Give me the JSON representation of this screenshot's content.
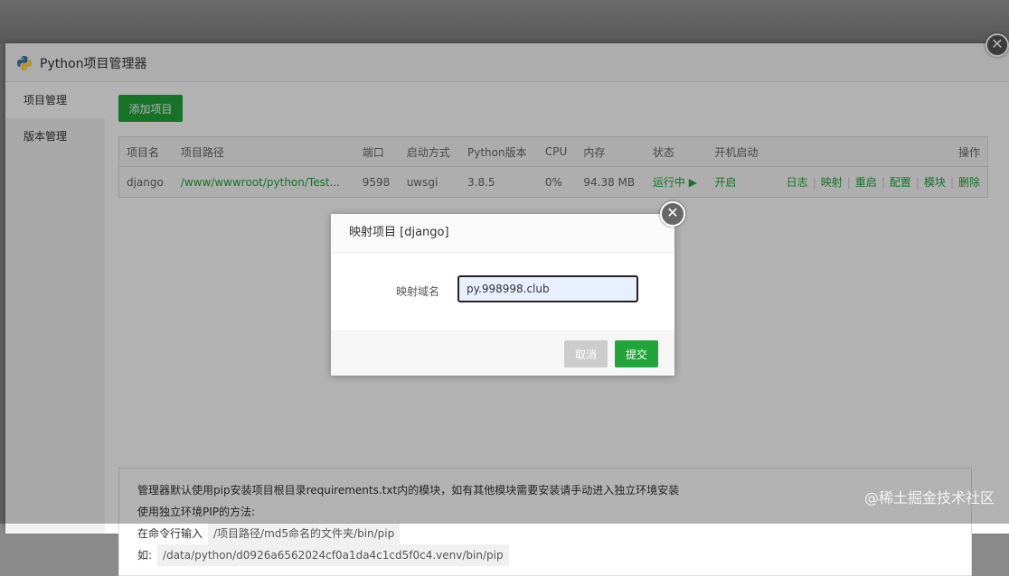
{
  "window": {
    "title": "Python项目管理器"
  },
  "sidebar": {
    "items": [
      {
        "label": "项目管理"
      },
      {
        "label": "版本管理"
      }
    ]
  },
  "toolbar": {
    "add_label": "添加项目"
  },
  "table": {
    "headers": [
      "项目名",
      "项目路径",
      "端口",
      "启动方式",
      "Python版本",
      "CPU",
      "内存",
      "状态",
      "开机启动",
      "操作"
    ],
    "row": {
      "name": "django",
      "path": "/www/wwwroot/python/Test...",
      "port": "9598",
      "start_mode": "uwsgi",
      "python_version": "3.8.5",
      "cpu": "0%",
      "memory": "94.38 MB",
      "status": "运行中 ▶",
      "autostart": "开启",
      "ops": [
        "日志",
        "映射",
        "重启",
        "配置",
        "模块",
        "删除"
      ]
    }
  },
  "info": {
    "line1": "管理器默认使用pip安装项目根目录requirements.txt内的模块，如有其他模块需要安装请手动进入独立环境安装",
    "line2": "使用独立环境PIP的方法:",
    "line3_prefix": "在命令行输入",
    "line3_code": "/项目路径/md5命名的文件夹/bin/pip",
    "line4_prefix": "如:",
    "line4_code": "/data/python/d0926a6562024cf0a1da4c1cd5f0c4.venv/bin/pip"
  },
  "modal": {
    "title": "映射项目 [django]",
    "field_label": "映射域名",
    "field_value": "py.998998.club",
    "cancel_label": "取消",
    "submit_label": "提交"
  },
  "watermark": "@稀土掘金技术社区",
  "colors": {
    "accent": "#20a53a",
    "muted_button": "#cccccc"
  },
  "icons": {
    "window_logo": "python-logo-icon",
    "close": "close-icon"
  }
}
